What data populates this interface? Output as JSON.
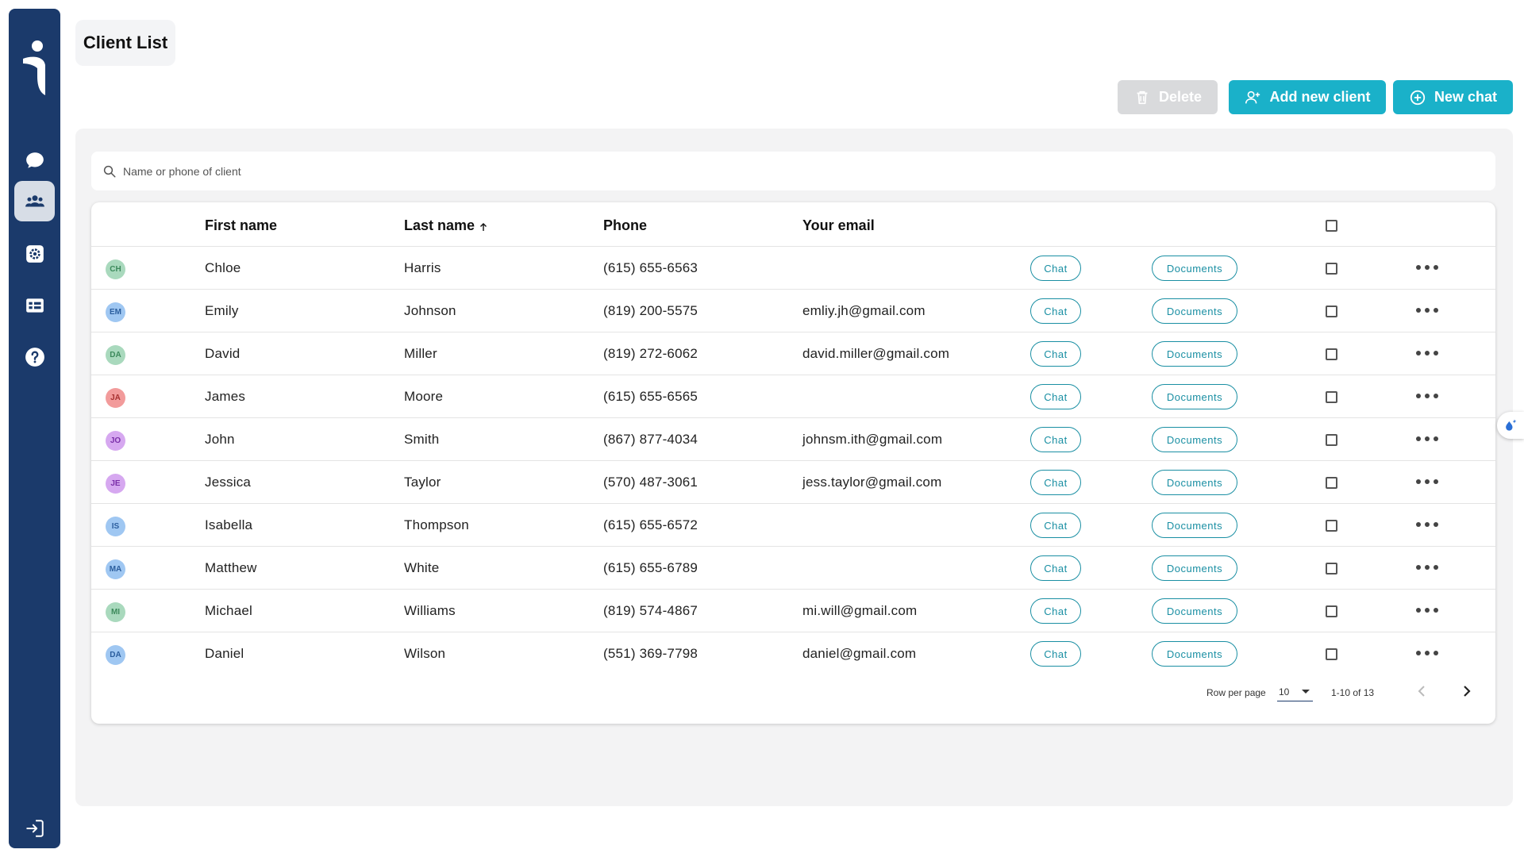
{
  "header": {
    "title": "Client List"
  },
  "actions": {
    "delete_label": "Delete",
    "add_client_label": "Add new client",
    "new_chat_label": "New chat"
  },
  "search": {
    "placeholder": "Name or phone of client"
  },
  "table": {
    "columns": {
      "first_name": "First name",
      "last_name": "Last name",
      "phone": "Phone",
      "email": "Your email"
    },
    "chat_label": "Chat",
    "documents_label": "Documents",
    "rows": [
      {
        "initials": "CH",
        "avatar_bg": "#a9d9bd",
        "avatar_fg": "#3d8a5c",
        "first": "Chloe",
        "last": "Harris",
        "phone": "(615) 655-6563",
        "email": ""
      },
      {
        "initials": "EM",
        "avatar_bg": "#9fc7f2",
        "avatar_fg": "#2b5e9e",
        "first": "Emily",
        "last": "Johnson",
        "phone": "(819) 200-5575",
        "email": "emliy.jh@gmail.com"
      },
      {
        "initials": "DA",
        "avatar_bg": "#a9d9bd",
        "avatar_fg": "#3d8a5c",
        "first": "David",
        "last": "Miller",
        "phone": "(819) 272-6062",
        "email": "david.miller@gmail.com"
      },
      {
        "initials": "JA",
        "avatar_bg": "#f29b9b",
        "avatar_fg": "#a83232",
        "first": "James",
        "last": "Moore",
        "phone": "(615) 655-6565",
        "email": ""
      },
      {
        "initials": "JO",
        "avatar_bg": "#d6a8f0",
        "avatar_fg": "#7a2fa8",
        "first": "John",
        "last": "Smith",
        "phone": "(867) 877-4034",
        "email": "johnsm.ith@gmail.com"
      },
      {
        "initials": "JE",
        "avatar_bg": "#d6a8f0",
        "avatar_fg": "#7a2fa8",
        "first": "Jessica",
        "last": "Taylor",
        "phone": "(570) 487-3061",
        "email": "jess.taylor@gmail.com"
      },
      {
        "initials": "IS",
        "avatar_bg": "#9fc7f2",
        "avatar_fg": "#2b5e9e",
        "first": "Isabella",
        "last": "Thompson",
        "phone": "(615) 655-6572",
        "email": ""
      },
      {
        "initials": "MA",
        "avatar_bg": "#9fc7f2",
        "avatar_fg": "#2b5e9e",
        "first": "Matthew",
        "last": "White",
        "phone": "(615) 655-6789",
        "email": ""
      },
      {
        "initials": "MI",
        "avatar_bg": "#a9d9bd",
        "avatar_fg": "#3d8a5c",
        "first": "Michael",
        "last": "Williams",
        "phone": "(819) 574-4867",
        "email": "mi.will@gmail.com"
      },
      {
        "initials": "DA",
        "avatar_bg": "#9fc7f2",
        "avatar_fg": "#2b5e9e",
        "first": "Daniel",
        "last": "Wilson",
        "phone": "(551) 369-7798",
        "email": "daniel@gmail.com"
      }
    ]
  },
  "pagination": {
    "rows_label": "Row per page",
    "rows_value": "10",
    "range": "1-10 of 13"
  },
  "colors": {
    "sidebar": "#1b3a6b",
    "accent": "#1ab1c9",
    "outline": "#1a8fa3",
    "disabled": "#d9dadc"
  },
  "icons": {
    "sidebar": [
      "logo-icon",
      "chat-bubble-icon",
      "clients-icon",
      "settings-icon",
      "templates-icon",
      "help-icon",
      "logout-icon"
    ],
    "buttons": [
      "trash-icon",
      "add-person-icon",
      "add-circle-icon"
    ],
    "search": "search-icon",
    "floating": "magic-icon"
  }
}
